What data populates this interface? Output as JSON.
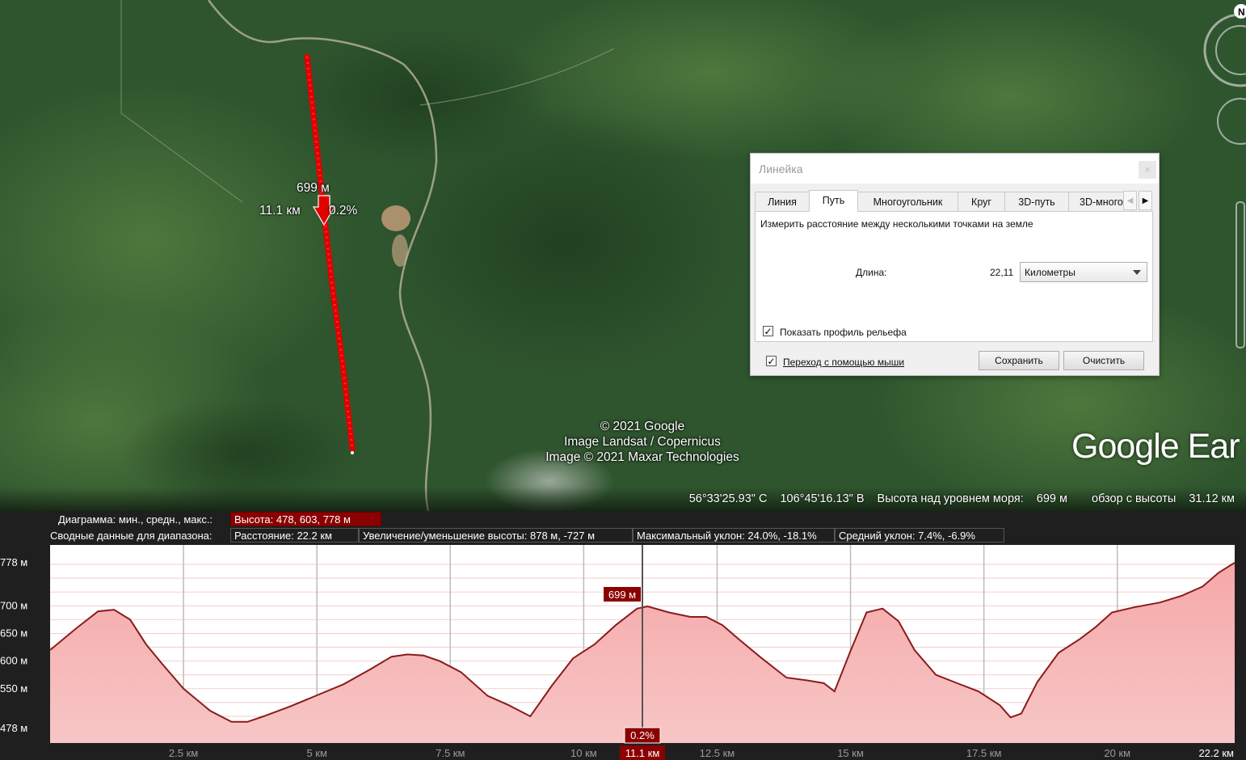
{
  "map": {
    "attribution": [
      "© 2021 Google",
      "Image Landsat / Copernicus",
      "Image © 2021 Maxar Technologies"
    ],
    "logo_text": "Google Ear",
    "path_marker": {
      "elevation": "699 м",
      "distance": "11.1 км",
      "slope": "0.2%"
    },
    "path_color": "#e00000"
  },
  "status": {
    "latitude": "56°33'25.93\" С",
    "longitude": "106°45'16.13\" В",
    "elevation_label": "Высота над уровнем моря:",
    "elevation_value": "699 м",
    "eye_label": "обзор с высоты",
    "eye_value": "31.12 км"
  },
  "ruler": {
    "title": "Линейка",
    "close": "×",
    "tabs": [
      "Линия",
      "Путь",
      "Многоугольник",
      "Круг",
      "3D-путь",
      "3D-многоугольник"
    ],
    "active_tab": "Путь",
    "description": "Измерить расстояние между несколькими точками на земле",
    "length_label": "Длина:",
    "length_value": "22,11",
    "units": "Километры",
    "show_profile_label": "Показать профиль рельефа",
    "show_profile_checked": true,
    "mouse_nav_label": "Переход с помощью мыши",
    "mouse_nav_checked": true,
    "save_label": "Сохранить",
    "clear_label": "Очистить",
    "check_glyph": "✓",
    "scroll_left": "◀",
    "scroll_right": "▶"
  },
  "profile": {
    "diagram_label": "Диаграмма: мин., средн., макс.:",
    "height_summary": "Высота: 478, 603, 778 м",
    "range_label": "Сводные данные для диапазона:",
    "distance_summary": "Расстояние: 22.2 км",
    "gain_summary": "Увеличение/уменьшение высоты: 878 м, -727 м",
    "max_slope_summary": "Максимальный уклон: 24.0%, -18.1%",
    "avg_slope_summary": "Средний уклон: 7.4%, -6.9%",
    "highlight_color": "#8b0000"
  },
  "chart_data": {
    "type": "area",
    "title": "",
    "xlabel": "",
    "ylabel": "",
    "xlim": [
      0,
      22.2
    ],
    "ylim": [
      478,
      778
    ],
    "x_ticks": [
      {
        "value": 2.5,
        "label": "2.5 км"
      },
      {
        "value": 5,
        "label": "5 км"
      },
      {
        "value": 7.5,
        "label": "7.5 км"
      },
      {
        "value": 10,
        "label": "10 км"
      },
      {
        "value": 12.5,
        "label": "12.5 км"
      },
      {
        "value": 15,
        "label": "15 км"
      },
      {
        "value": 17.5,
        "label": "17.5 км"
      },
      {
        "value": 20,
        "label": "20 км"
      },
      {
        "value": 22.2,
        "label": "22.2 км"
      }
    ],
    "y_ticks": [
      {
        "value": 778,
        "label": "778 м"
      },
      {
        "value": 700,
        "label": "700 м"
      },
      {
        "value": 650,
        "label": "650 м"
      },
      {
        "value": 600,
        "label": "600 м"
      },
      {
        "value": 550,
        "label": "550 м"
      },
      {
        "value": 478,
        "label": "478 м"
      }
    ],
    "cursor": {
      "x": 11.1,
      "x_label": "11.1 км",
      "y": 699,
      "y_label": "699 м",
      "slope_label": "0.2%"
    },
    "grid": true,
    "series": [
      {
        "x": [
          0,
          0.5,
          0.9,
          1.2,
          1.5,
          1.8,
          2.1,
          2.5,
          3.0,
          3.4,
          3.7,
          4.0,
          4.5,
          5.0,
          5.5,
          6.0,
          6.4,
          6.7,
          7.0,
          7.3,
          7.7,
          8.2,
          8.6,
          9.0,
          9.4,
          9.8,
          10.2,
          10.6,
          11.0,
          11.2,
          11.6,
          12.0,
          12.3,
          12.6,
          12.9,
          13.3,
          13.8,
          14.2,
          14.5,
          14.7,
          15.0,
          15.3,
          15.6,
          15.9,
          16.2,
          16.6,
          17.0,
          17.4,
          17.8,
          18.0,
          18.2,
          18.5,
          18.9,
          19.3,
          19.6,
          19.9,
          20.3,
          20.8,
          21.2,
          21.6,
          21.9,
          22.2
        ],
        "y": [
          620,
          660,
          690,
          693,
          675,
          630,
          595,
          550,
          510,
          490,
          490,
          500,
          518,
          538,
          558,
          585,
          608,
          612,
          610,
          600,
          580,
          537,
          520,
          500,
          555,
          605,
          630,
          665,
          695,
          699,
          688,
          680,
          680,
          665,
          640,
          608,
          570,
          565,
          560,
          545,
          618,
          688,
          695,
          672,
          620,
          575,
          560,
          545,
          520,
          498,
          505,
          562,
          615,
          640,
          662,
          688,
          697,
          706,
          718,
          735,
          760,
          778
        ]
      }
    ]
  }
}
